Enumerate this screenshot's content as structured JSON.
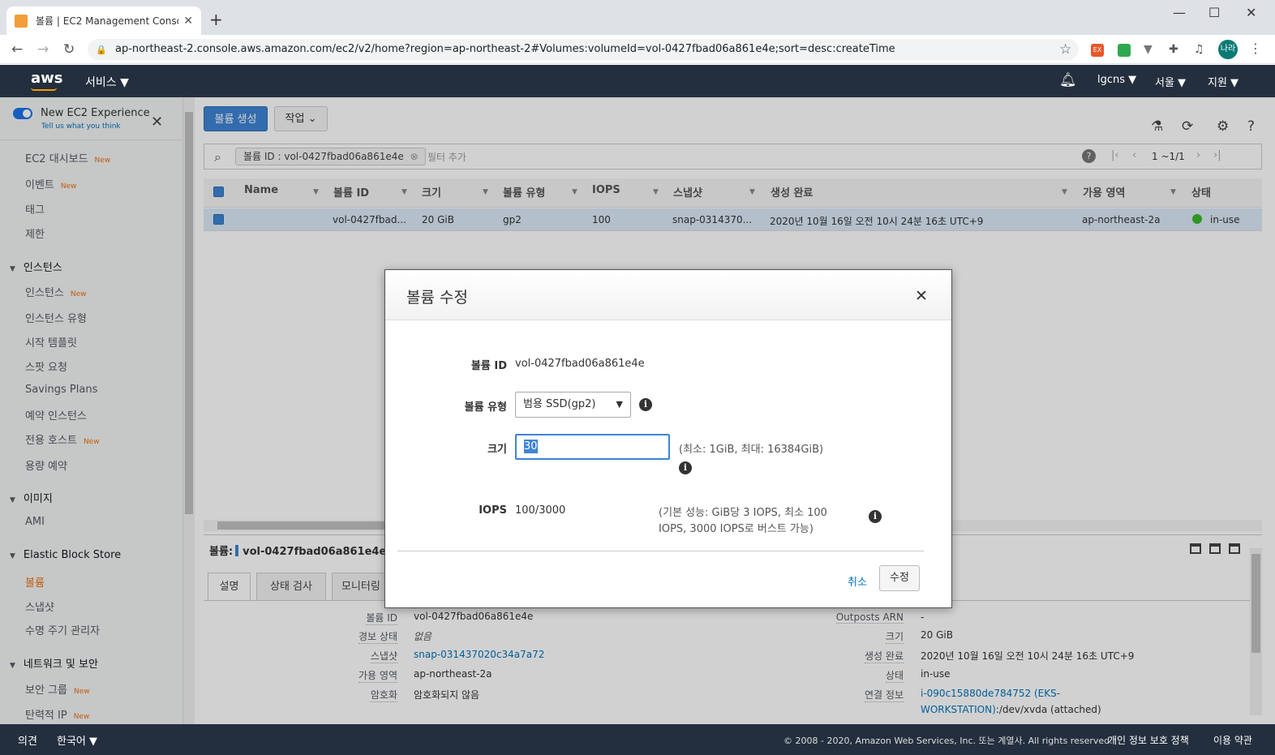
{
  "browser": {
    "tab_title": "볼륨 | EC2 Management Consol",
    "url": "ap-northeast-2.console.aws.amazon.com/ec2/v2/home?region=ap-northeast-2#Volumes:volumeId=vol-0427fbad06a861e4e;sort=desc:createTime",
    "avatar": "나라",
    "ext_label": "EX"
  },
  "topbar": {
    "logo": "aws",
    "services": "서비스 ▼",
    "account": "lgcns ▼",
    "region": "서울 ▼",
    "support": "지원 ▼"
  },
  "sidebar": {
    "new_exp": "New EC2 Experience",
    "tell_us": "Tell us what you think",
    "new_badge": "New",
    "items": {
      "dashboard": "EC2 대시보드",
      "events": "이벤트",
      "tags": "태그",
      "limits": "제한",
      "instances_head": "인스턴스",
      "instances": "인스턴스",
      "instance_types": "인스턴스 유형",
      "launch_templates": "시작 템플릿",
      "spot": "스팟 요청",
      "savings": "Savings Plans",
      "reserved": "예약 인스턴스",
      "dedicated": "전용 호스트",
      "capacity": "용량 예약",
      "images_head": "이미지",
      "ami": "AMI",
      "ebs_head": "Elastic Block Store",
      "volumes": "볼륨",
      "snapshots": "스냅샷",
      "lifecycle": "수명 주기 관리자",
      "network_head": "네트워크 및 보안",
      "security_groups": "보안 그룹",
      "elastic_ip": "탄력적 IP"
    }
  },
  "toolbar": {
    "create_volume": "볼륨 생성",
    "actions": "작업 ⌄"
  },
  "filter": {
    "chip": "볼륨 ID : vol-0427fbad06a861e4e",
    "add_filter": "필터 추가",
    "help": "?",
    "page": "1 ~1/1"
  },
  "table": {
    "headers": [
      "Name",
      "볼륨 ID",
      "크기",
      "볼륨 유형",
      "IOPS",
      "스냅샷",
      "생성 완료",
      "가용 영역",
      "상태"
    ],
    "row": {
      "name": "",
      "volume_id": "vol-0427fbad...",
      "size": "20 GiB",
      "type": "gp2",
      "iops": "100",
      "snapshot": "snap-0314370...",
      "created": "2020년 10월 16일 오전 10시 24분 16초 UTC+9",
      "az": "ap-northeast-2a",
      "state": "in-use"
    }
  },
  "details": {
    "volume_label": "볼륨:",
    "volume_id": "vol-0427fbad06a861e4e",
    "tabs": [
      "설명",
      "상태 검사",
      "모니터링"
    ],
    "left": [
      {
        "label": "볼륨 ID",
        "value": "vol-0427fbad06a861e4e"
      },
      {
        "label": "경보 상태",
        "value": "없음"
      },
      {
        "label": "스냅샷",
        "value": "snap-031437020c34a7a72"
      },
      {
        "label": "가용 영역",
        "value": "ap-northeast-2a"
      },
      {
        "label": "암호화",
        "value": "암호화되지 않음"
      }
    ],
    "right": [
      {
        "label": "Outposts ARN",
        "value": "-"
      },
      {
        "label": "크기",
        "value": "20 GiB"
      },
      {
        "label": "생성 완료",
        "value": "2020년 10월 16일 오전 10시 24분 16초 UTC+9"
      },
      {
        "label": "상태",
        "value": "in-use"
      },
      {
        "label": "연결 정보",
        "value": "i-090c15880de784752 (EKS-"
      },
      {
        "label": "",
        "value": "WORKSTATION)"
      }
    ],
    "attach_suffix": ":/dev/xvda (attached)"
  },
  "modal": {
    "title": "볼륨 수정",
    "volume_id_label": "볼륨 ID",
    "volume_id": "vol-0427fbad06a861e4e",
    "type_label": "볼륨 유형",
    "type_value": "범용 SSD(gp2)",
    "size_label": "크기",
    "size_value": "30",
    "size_hint": "(최소: 1GiB, 최대: 16384GiB)",
    "iops_label": "IOPS",
    "iops_value": "100/3000",
    "iops_hint_1": "(기본 성능: GiB당 3 IOPS, 최소 100",
    "iops_hint_2": "IOPS, 3000 IOPS로 버스트 가능)",
    "cancel": "취소",
    "submit": "수정"
  },
  "footer": {
    "feedback": "의견",
    "language": "한국어 ▼",
    "copyright": "© 2008 - 2020, Amazon Web Services, Inc. 또는 계열사. All rights reserved.",
    "privacy": "개인 정보 보호 정책",
    "terms": "이용 약관"
  },
  "colors": {
    "aws_nav": "#232f3e",
    "primary": "#3f84d4",
    "orange": "#ec7211",
    "link": "#0073bb"
  }
}
